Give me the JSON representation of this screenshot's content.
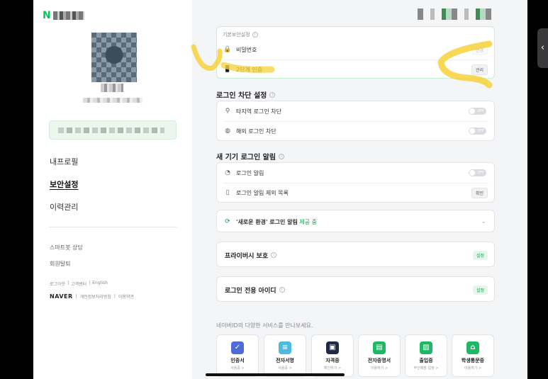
{
  "sidebar": {
    "logo_letter": "N",
    "menu": [
      {
        "label": "내프로필",
        "active": false
      },
      {
        "label": "보안설정",
        "active": true
      },
      {
        "label": "이력관리",
        "active": false
      }
    ],
    "sub_links": [
      "스마트봇 상담",
      "회원탈퇴"
    ],
    "footer_links": [
      "로그아웃",
      "고객센터",
      "English"
    ],
    "footer_brand": "NAVER",
    "footer_policy": [
      "개인정보처리방침",
      "이용약관"
    ]
  },
  "main": {
    "password_section": {
      "heading": "기본보안설정",
      "rows": [
        {
          "icon": "lock-icon",
          "glyph": "🔒",
          "label": "비밀번호",
          "action": "변경"
        },
        {
          "icon": "phone-icon",
          "glyph": "📱",
          "label": "2단계 인증",
          "action": "관리"
        }
      ]
    },
    "login_block": {
      "title": "로그인 차단 설정",
      "rows": [
        {
          "icon": "location-pin-icon",
          "glyph": "⚲",
          "label": "타지역 로그인 차단",
          "toggle": "OFF"
        },
        {
          "icon": "globe-icon",
          "glyph": "◍",
          "label": "해외 로그인 차단",
          "toggle": "OFF"
        }
      ]
    },
    "new_device": {
      "title": "새 기기 로그인 알림",
      "rows": [
        {
          "icon": "bell-icon",
          "glyph": "◔",
          "label": "로그인 알림",
          "toggle": "OFF"
        },
        {
          "icon": "device-icon",
          "glyph": "▯",
          "label": "로그인 알림 제외 목록",
          "action": "확인"
        }
      ]
    },
    "new_env": {
      "prefix": "'새로운 환경' 로그인 알림",
      "status": "제공 중"
    },
    "privacy": {
      "title": "프라이버시 보호",
      "action": "설정"
    },
    "login_only_id": {
      "title": "로그인 전용 아이디",
      "action": "설정"
    },
    "services_heading": "네이버ID의 다양한 서비스를 만나보세요.",
    "services": [
      {
        "name": "인증서",
        "sub": "사용중 >",
        "color": "#4f6bd8",
        "glyph": "✓",
        "icon": "shield-icon"
      },
      {
        "name": "전자서명",
        "sub": "사용중 >",
        "color": "#4db8e0",
        "glyph": "≡",
        "icon": "document-icon"
      },
      {
        "name": "자격증",
        "sub": "확인하기 >",
        "color": "#1f2a44",
        "glyph": "▣",
        "icon": "license-icon"
      },
      {
        "name": "전자증명서",
        "sub": "이용하기 >",
        "color": "#20b765",
        "glyph": "▤",
        "icon": "certificate-icon"
      },
      {
        "name": "출입증",
        "sub": "무인매장 입장 >",
        "color": "#20b765",
        "glyph": "▨",
        "icon": "pass-icon"
      },
      {
        "name": "학생통문증",
        "sub": "이용하기 >",
        "color": "#20b765",
        "glyph": "⌂",
        "icon": "school-icon"
      }
    ]
  },
  "colors": {
    "naver_green": "#03c75a",
    "highlight": "#f6d23a"
  }
}
